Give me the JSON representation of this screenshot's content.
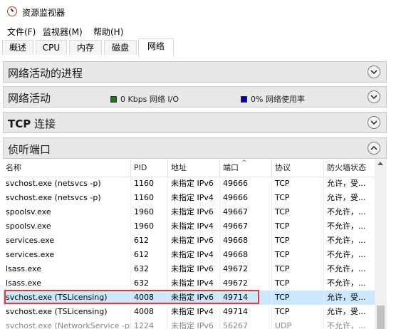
{
  "window": {
    "title": "资源监视器"
  },
  "menu": {
    "file": "文件(F)",
    "monitor": "监视器(M)",
    "help": "帮助(H)"
  },
  "tabs": [
    "概述",
    "CPU",
    "内存",
    "磁盘",
    "网络"
  ],
  "active_tab": "网络",
  "sections": {
    "processes": {
      "title": "网络活动的进程"
    },
    "activity": {
      "title": "网络活动",
      "io": "0 Kbps 网络 I/O",
      "usage": "0% 网络使用率"
    },
    "tcp": {
      "title_bold": "TCP",
      "title_rest": " 连接"
    },
    "listening": {
      "title": "侦听端口"
    }
  },
  "table": {
    "columns": [
      "名称",
      "PID",
      "地址",
      "端口",
      "协议",
      "防火墙状态"
    ],
    "rows": [
      [
        "svchost.exe (netsvcs -p)",
        "1160",
        "未指定 IPv6",
        "49666",
        "TCP",
        "允许，受..."
      ],
      [
        "svchost.exe (netsvcs -p)",
        "1160",
        "未指定 IPv4",
        "49666",
        "TCP",
        "允许，受..."
      ],
      [
        "spoolsv.exe",
        "1960",
        "未指定 IPv6",
        "49667",
        "TCP",
        "不允许，..."
      ],
      [
        "spoolsv.exe",
        "1960",
        "未指定 IPv4",
        "49667",
        "TCP",
        "不允许，..."
      ],
      [
        "services.exe",
        "612",
        "未指定 IPv6",
        "49668",
        "TCP",
        "不允许，..."
      ],
      [
        "services.exe",
        "612",
        "未指定 IPv4",
        "49668",
        "TCP",
        "不允许，..."
      ],
      [
        "lsass.exe",
        "632",
        "未指定 IPv6",
        "49672",
        "TCP",
        "不允许，..."
      ],
      [
        "lsass.exe",
        "632",
        "未指定 IPv4",
        "49672",
        "TCP",
        "不允许，..."
      ],
      [
        "svchost.exe (TSLicensing)",
        "4008",
        "未指定 IPv6",
        "49714",
        "TCP",
        "允许，受..."
      ],
      [
        "svchost.exe (TSLicensing)",
        "4008",
        "未指定 IPv4",
        "49714",
        "TCP",
        "允许，受..."
      ],
      [
        "svchost.exe (NetworkService -p)",
        "1224",
        "未指定 IPv6",
        "56267",
        "UDP",
        "不允许，..."
      ]
    ],
    "selected_row": 8
  },
  "colors": {
    "io_square": "#1a7a1a",
    "usage_square": "#0000b0",
    "selection": "#cce8ff",
    "highlight": "#e53935"
  }
}
